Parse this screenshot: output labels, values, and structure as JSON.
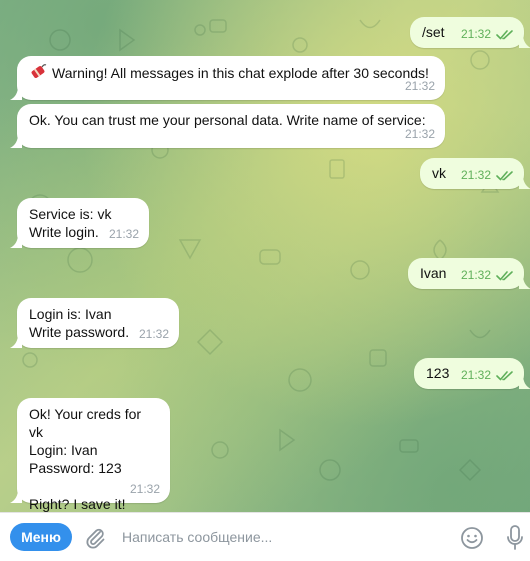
{
  "messages": [
    {
      "side": "out",
      "text": "/set",
      "time": "21:32",
      "read": true
    },
    {
      "side": "in",
      "icon": "dynamite-icon",
      "text": "Warning! All messages in this chat explode after 30 seconds!",
      "time": "21:32"
    },
    {
      "side": "in",
      "text": "Ok. You can trust me your personal data. Write name of service:",
      "time": "21:32"
    },
    {
      "side": "out",
      "text": "vk",
      "time": "21:32",
      "read": true
    },
    {
      "side": "in",
      "text": "Service is: vk\nWrite login.",
      "time": "21:32"
    },
    {
      "side": "out",
      "text": "Ivan",
      "time": "21:32",
      "read": true
    },
    {
      "side": "in",
      "text": "Login is: Ivan\nWrite password.",
      "time": "21:32"
    },
    {
      "side": "out",
      "text": "123",
      "time": "21:32",
      "read": true
    },
    {
      "side": "in",
      "text": "Ok! Your creds for vk\nLogin: Ivan\nPassword: 123\n\nRight? I save it!",
      "time": "21:32"
    }
  ],
  "composer": {
    "menu_label": "Меню",
    "placeholder": "Написать сообщение..."
  },
  "colors": {
    "accent": "#3390ec",
    "incoming_bubble": "#ffffff",
    "outgoing_bubble": "#effdde",
    "read_check": "#5fb05a"
  }
}
